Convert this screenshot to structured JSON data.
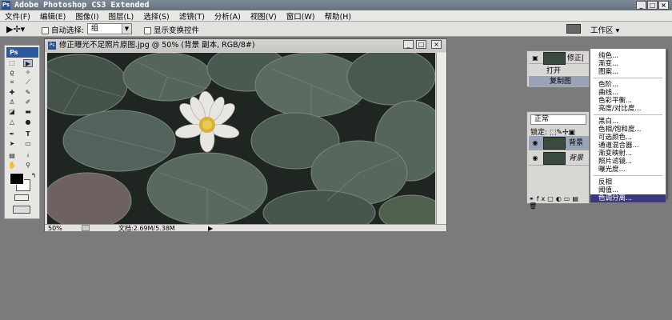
{
  "app": {
    "title": "Adobe Photoshop CS3 Extended",
    "logo": "Ps"
  },
  "menubar": [
    "文件(F)",
    "编辑(E)",
    "图像(I)",
    "图层(L)",
    "选择(S)",
    "滤镜(T)",
    "分析(A)",
    "视图(V)",
    "窗口(W)",
    "帮助(H)"
  ],
  "options": {
    "auto_select_label": "自动选择:",
    "auto_select_value": "组",
    "show_transform_label": "显示变换控件",
    "workspace_label": "工作区"
  },
  "document": {
    "title": "修正曝光不足照片原图.jpg @ 50% (背景 副本, RGB/8#)",
    "zoom": "50%",
    "doc_info": "文档:2.69M/5.38M"
  },
  "layers_top": {
    "rows": [
      {
        "name": "修正|"
      },
      {
        "name": "打开"
      },
      {
        "name": "复制图"
      }
    ]
  },
  "layers_panel": {
    "blend_mode": "正常",
    "lock_label": "锁定:",
    "layers": [
      {
        "name": "背景"
      },
      {
        "name": "背景"
      }
    ]
  },
  "adjust_menu": {
    "groups": [
      [
        "纯色...",
        "渐变...",
        "图案..."
      ],
      [
        "色阶...",
        "曲线...",
        "色彩平衡...",
        "亮度/对比度..."
      ],
      [
        "黑白...",
        "色相/饱和度...",
        "可选颜色...",
        "通道混合器...",
        "渐变映射...",
        "照片滤镜...",
        "曝光度..."
      ],
      [
        "反相",
        "阈值...",
        "色调分离..."
      ]
    ],
    "selected": "色调分离..."
  },
  "icons": {
    "move_tool": "move-tool-icon",
    "close": "close-icon",
    "minimize": "minimize-icon",
    "maximize": "maximize-icon",
    "eye": "eye-icon"
  },
  "colors": {
    "foreground": "#000000",
    "background": "#ffffff",
    "menu_highlight": "#3a3a7a"
  }
}
